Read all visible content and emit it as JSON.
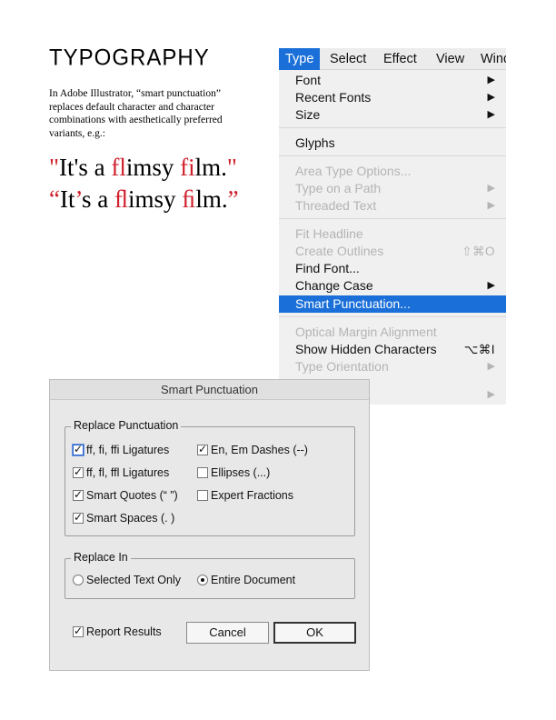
{
  "article": {
    "title": "TYPOGRAPHY",
    "body": "In Adobe Illustrator, “smart punctuation” replaces default character and character combinations with aesthetically preferred variants, e.g.:",
    "sample_plain": {
      "q_open": "\"",
      "t1": "It's a ",
      "lig1": "fl",
      "t2": "imsy ",
      "lig2": "fi",
      "t3": "lm.",
      "q_close": "\""
    },
    "sample_smart": {
      "q_open": "“",
      "t1": "It",
      "apos": "’",
      "t1b": "s a ",
      "lig1": "ﬂ",
      "t2": "imsy ",
      "lig2": "ﬁ",
      "t3": "lm.",
      "q_close": "”"
    },
    "accent_color": "#d01f2b"
  },
  "menubar": {
    "items": [
      "Type",
      "Select",
      "Effect",
      "View",
      "Wind"
    ],
    "active": "Type"
  },
  "type_menu": {
    "items": [
      {
        "label": "Font",
        "arrow": "▶",
        "enabled": true
      },
      {
        "label": "Recent Fonts",
        "arrow": "▶",
        "enabled": true
      },
      {
        "label": "Size",
        "arrow": "▶",
        "enabled": true
      },
      {
        "label": "Glyphs",
        "enabled": true
      },
      {
        "label": "Area Type Options...",
        "enabled": false
      },
      {
        "label": "Type on a Path",
        "arrow": "▶",
        "enabled": false
      },
      {
        "label": "Threaded Text",
        "arrow": "▶",
        "enabled": false
      },
      {
        "label": "Fit Headline",
        "enabled": false
      },
      {
        "label": "Create Outlines",
        "shortcut": "⇧⌘O",
        "enabled": false
      },
      {
        "label": "Find Font...",
        "enabled": true
      },
      {
        "label": "Change Case",
        "arrow": "▶",
        "enabled": true
      },
      {
        "label": "Smart Punctuation...",
        "enabled": true,
        "highlighted": true
      },
      {
        "label": "Optical Margin Alignment",
        "enabled": false
      },
      {
        "label": "Show Hidden Characters",
        "shortcut": "⌥⌘I",
        "enabled": true
      },
      {
        "label": "Type Orientation",
        "arrow": "▶",
        "enabled": false
      },
      {
        "label": "",
        "arrow": "▶",
        "enabled": false
      }
    ],
    "highlight_color": "#1a6fd8"
  },
  "dialog": {
    "title": "Smart Punctuation",
    "replace_punctuation": {
      "legend": "Replace Punctuation",
      "options": {
        "ff_fi_ffi": {
          "label": "ff, fi, ffi Ligatures",
          "checked": true
        },
        "ff_fl_ffl": {
          "label": "ff, fl, ffl Ligatures",
          "checked": true
        },
        "smart_quotes": {
          "label": "Smart Quotes (“ ”)",
          "checked": true
        },
        "smart_spaces": {
          "label": "Smart Spaces (. )",
          "checked": true
        },
        "en_em_dashes": {
          "label": "En, Em Dashes (--)",
          "checked": true
        },
        "ellipses": {
          "label": "Ellipses (...)",
          "checked": false
        },
        "expert_fractions": {
          "label": "Expert Fractions",
          "checked": false
        }
      }
    },
    "replace_in": {
      "legend": "Replace In",
      "selected_text": {
        "label": "Selected Text Only",
        "selected": false
      },
      "entire_document": {
        "label": "Entire Document",
        "selected": true
      }
    },
    "report_results": {
      "label": "Report Results",
      "checked": true
    },
    "cancel_label": "Cancel",
    "ok_label": "OK",
    "check_glyph": "✓"
  }
}
